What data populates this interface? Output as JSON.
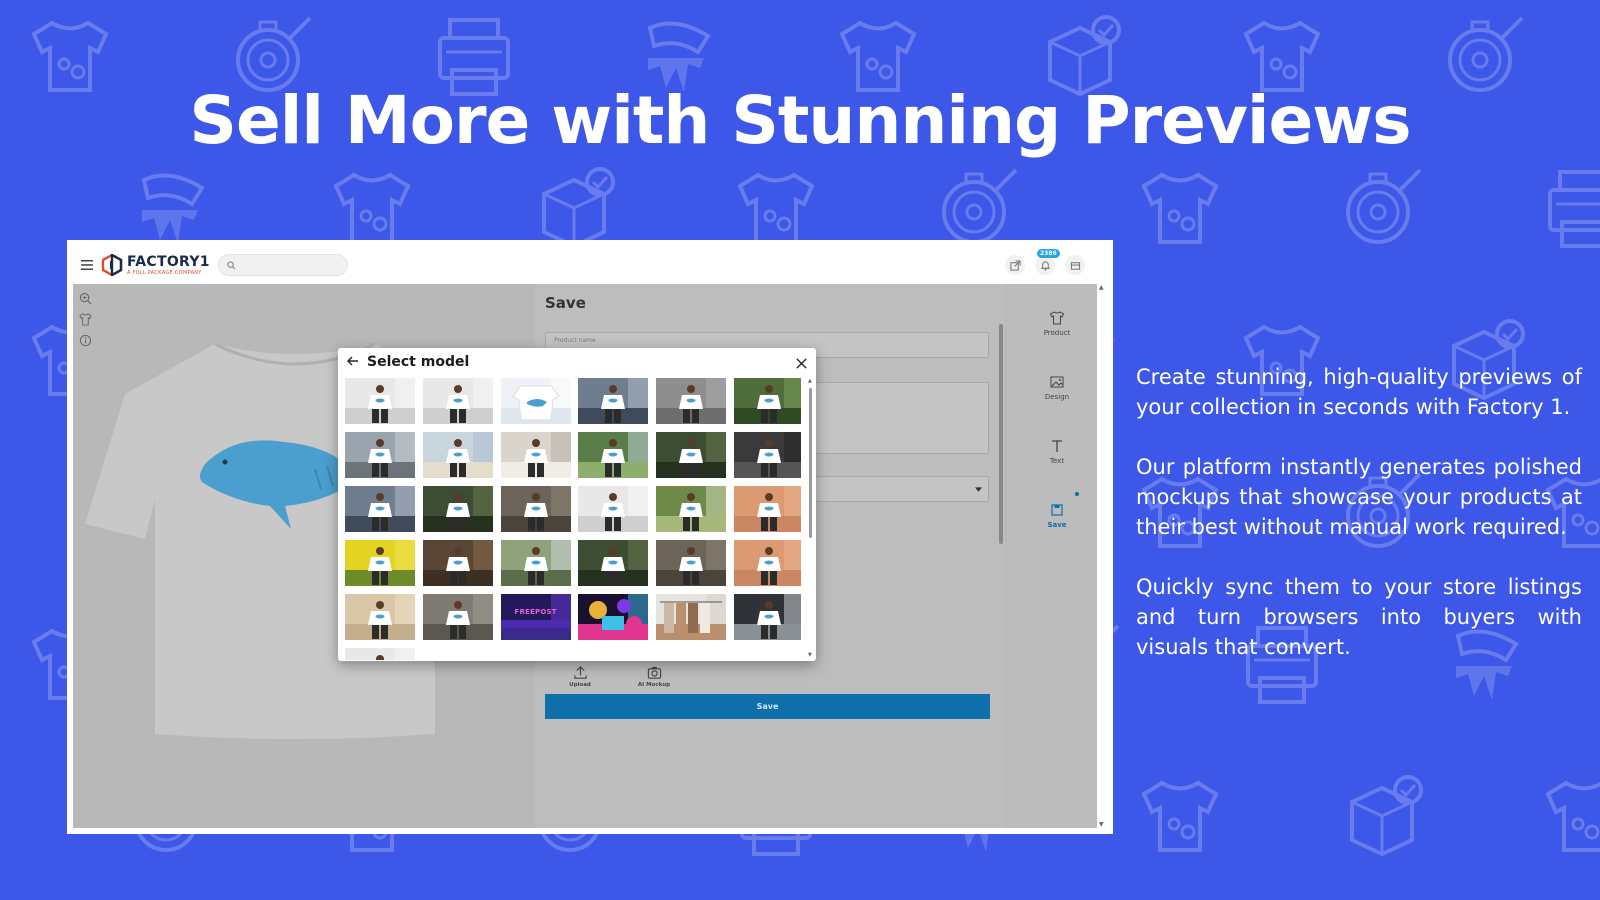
{
  "headline": "Sell More with Stunning Previews",
  "app": {
    "logo_name": "FACTORY1",
    "logo_tagline": "A FULL PACKAGE COMPANY",
    "search_placeholder": "",
    "notification_count": "2386"
  },
  "save_panel": {
    "title": "Save",
    "product_name_hint": "Product name",
    "upload_label": "Upload",
    "ai_mockup_label": "AI Mockup",
    "save_button": "Save"
  },
  "rail": {
    "product": "Product",
    "design": "Design",
    "text": "Text",
    "save": "Save"
  },
  "modal": {
    "title": "Select model",
    "thumbnails": [
      {
        "scene": "studio-light",
        "print_text": ""
      },
      {
        "scene": "studio-light",
        "print_text": ""
      },
      {
        "scene": "flat-lay",
        "print_text": ""
      },
      {
        "scene": "city",
        "print_text": ""
      },
      {
        "scene": "concrete",
        "print_text": ""
      },
      {
        "scene": "park",
        "print_text": ""
      },
      {
        "scene": "bridge",
        "print_text": ""
      },
      {
        "scene": "beach",
        "print_text": ""
      },
      {
        "scene": "street-white",
        "print_text": ""
      },
      {
        "scene": "field",
        "print_text": ""
      },
      {
        "scene": "forest",
        "print_text": ""
      },
      {
        "scene": "dark-wall",
        "print_text": ""
      },
      {
        "scene": "city",
        "print_text": ""
      },
      {
        "scene": "forest",
        "print_text": ""
      },
      {
        "scene": "rocks",
        "print_text": ""
      },
      {
        "scene": "studio-light",
        "print_text": ""
      },
      {
        "scene": "meadow",
        "print_text": ""
      },
      {
        "scene": "peach",
        "print_text": ""
      },
      {
        "scene": "yellow",
        "print_text": ""
      },
      {
        "scene": "wood-flat",
        "print_text": ""
      },
      {
        "scene": "coast",
        "print_text": ""
      },
      {
        "scene": "forest",
        "print_text": ""
      },
      {
        "scene": "rocks",
        "print_text": ""
      },
      {
        "scene": "peach",
        "print_text": ""
      },
      {
        "scene": "sand",
        "print_text": ""
      },
      {
        "scene": "stone",
        "print_text": ""
      },
      {
        "scene": "purple-banner",
        "print_text": "FREEPOST"
      },
      {
        "scene": "neon",
        "print_text": ""
      },
      {
        "scene": "rack",
        "print_text": ""
      },
      {
        "scene": "print-shop",
        "print_text": ""
      },
      {
        "scene": "studio-light",
        "print_text": ""
      }
    ]
  },
  "copy": [
    "Create stunning, high-quality previews of your collection in seconds with Factory 1.",
    "Our platform instantly generates polished mockups that showcase your products at their best without manual work required.",
    "Quickly sync them to your store listings and turn browsers into buyers with visuals that convert."
  ],
  "colors": {
    "background": "#3d57e8",
    "accent": "#0e6fab",
    "shark": "#4a9fcf"
  }
}
